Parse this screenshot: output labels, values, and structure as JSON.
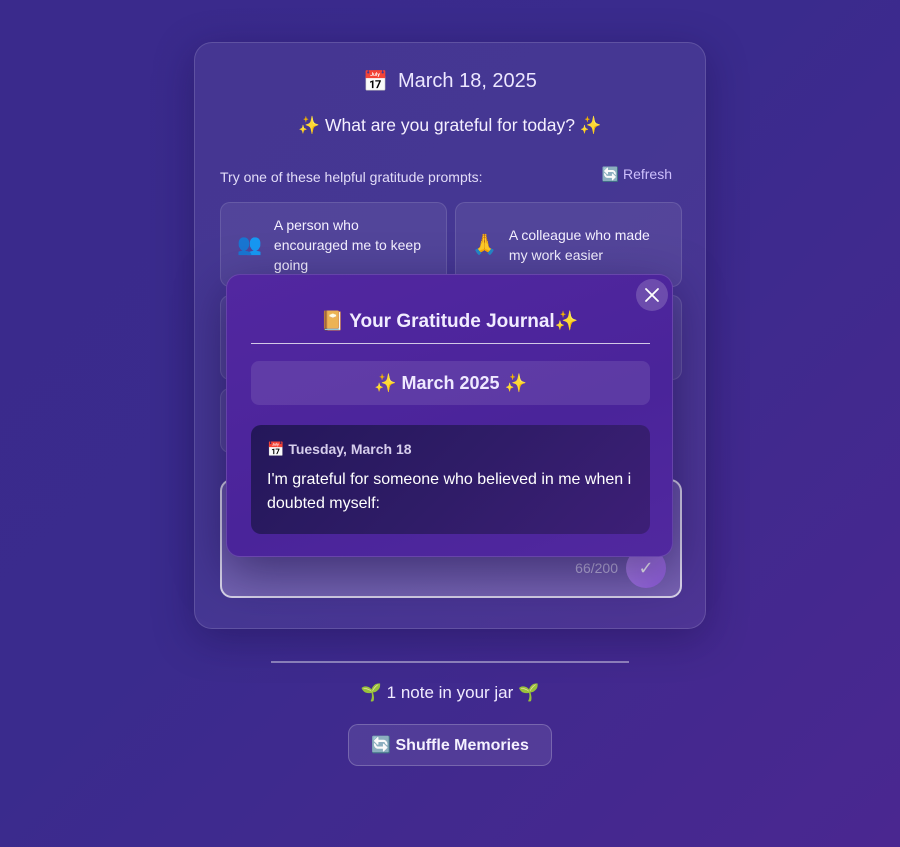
{
  "header": {
    "date_icon": "calendar-icon",
    "date": "March 18, 2025",
    "question": "✨ What are you grateful for today? ✨"
  },
  "prompts": {
    "hint": "Try one of these helpful gratitude prompts:",
    "refresh_label": "🔄 Refresh",
    "items": [
      {
        "icon": "people-icon",
        "emoji": "👥",
        "label": "A person who encouraged me to keep going"
      },
      {
        "icon": "praying-hands-icon",
        "emoji": "🙏",
        "label": "A colleague who made my work easier"
      }
    ]
  },
  "entry_input": {
    "counter": "66/200",
    "submit_label": "✓"
  },
  "jar": {
    "count_text": "🌱 1 note in your jar 🌱",
    "shuffle_label": "🔄 Shuffle Memories"
  },
  "modal": {
    "title": "📔 Your Gratitude Journal✨",
    "month": "✨ March 2025 ✨",
    "close_icon": "close-icon",
    "entries": [
      {
        "date": "📅 Tuesday, March 18",
        "text": "I'm grateful for someone who believed in me when i doubted myself:"
      }
    ]
  }
}
